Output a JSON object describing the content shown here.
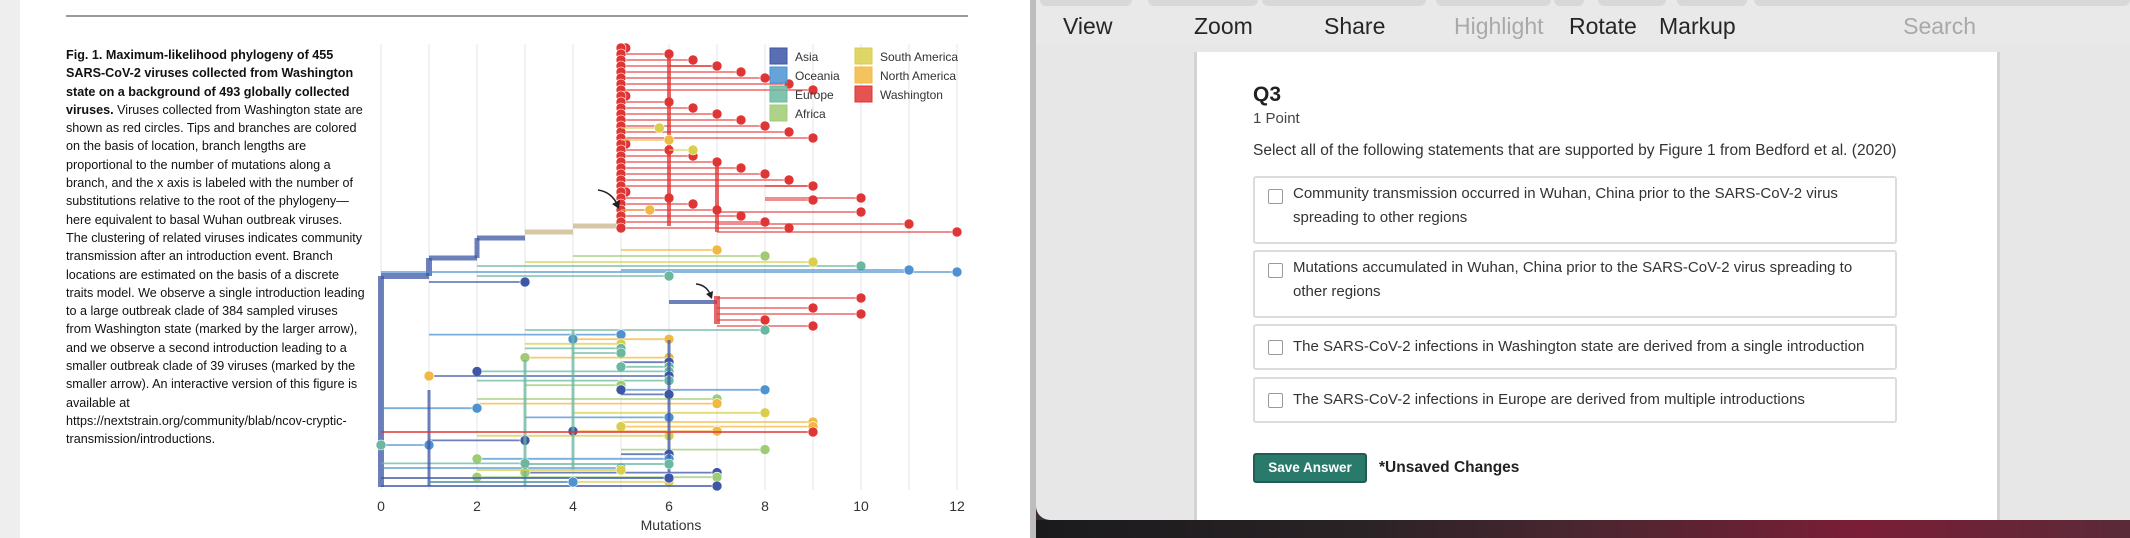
{
  "figure": {
    "caption_bold": "Fig. 1. Maximum-likelihood phylogeny of 455 SARS-CoV-2 viruses collected from Washington state on a background of 493 globally collected viruses.",
    "caption_rest": "Viruses collected from Washington state are shown as red circles. Tips and branches are colored on the basis of location, branch lengths are proportional to the number of mutations along a branch, and the x axis is labeled with the number of substitutions relative to the root of the phylogeny—here equivalent to basal Wuhan outbreak viruses. The clustering of related viruses indicates community transmission after an introduction event. Branch locations are estimated on the basis of a discrete traits model. We observe a single introduction leading to a large outbreak clade of 384 sampled viruses from Washington state (marked by the larger arrow), and we observe a second introduction leading to a smaller outbreak clade of 39 viruses (marked by the smaller arrow). An interactive version of this figure is available at https://nextstrain.org/community/blab/ncov-cryptic-transmission/introductions."
  },
  "chart_data": {
    "type": "scatter",
    "title": "",
    "xlabel": "Mutations",
    "ylabel": "",
    "x_ticks": [
      "0",
      "2",
      "4",
      "6",
      "8",
      "10",
      "12"
    ],
    "xlim": [
      0,
      12
    ],
    "grid": true,
    "legend_placement": "top-right",
    "legend": [
      {
        "name": "Asia",
        "color": "#3d56a6"
      },
      {
        "name": "Oceania",
        "color": "#4d93d1"
      },
      {
        "name": "Europe",
        "color": "#6ab8a0"
      },
      {
        "name": "Africa",
        "color": "#9fcb74"
      },
      {
        "name": "South America",
        "color": "#d9cf4c"
      },
      {
        "name": "North America",
        "color": "#f2b844"
      },
      {
        "name": "Washington",
        "color": "#e03535"
      }
    ]
  },
  "toolbar": {
    "view": "View",
    "zoom": "Zoom",
    "share": "Share",
    "highlight": "Highlight",
    "rotate": "Rotate",
    "markup": "Markup",
    "search_placeholder": "Search"
  },
  "question": {
    "title": "Q3",
    "points": "1 Point",
    "prompt": "Select all of the following statements that are supported by Figure 1 from Bedford et al. (2020)",
    "options": [
      {
        "text": "Community transmission occurred in Wuhan, China prior to the SARS-CoV-2 virus spreading to other regions"
      },
      {
        "text": "Mutations accumulated in Wuhan, China prior to the SARS-CoV-2 virus spreading to other regions"
      },
      {
        "text": "The SARS-CoV-2 infections in Washington state are derived from a single introduction"
      },
      {
        "text": "The SARS-CoV-2 infections in Europe are derived from multiple introductions"
      }
    ],
    "save_label": "Save Answer",
    "unsaved_label": "*Unsaved Changes"
  }
}
